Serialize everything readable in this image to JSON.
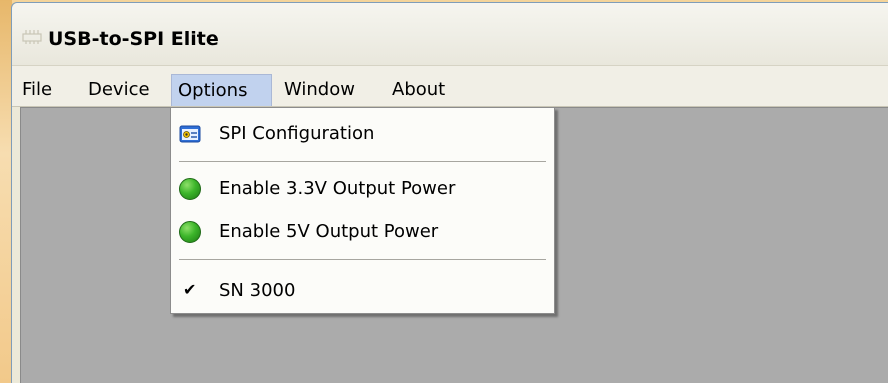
{
  "window": {
    "title": "USB-to-SPI Elite"
  },
  "menubar": {
    "items": [
      {
        "label": "File"
      },
      {
        "label": "Device"
      },
      {
        "label": "Options",
        "open": true
      },
      {
        "label": "Window"
      },
      {
        "label": "About"
      }
    ]
  },
  "options_menu": {
    "items": [
      {
        "label": "SPI Configuration",
        "icon": "config-window-icon"
      },
      {
        "label": "Enable 3.3V Output Power",
        "icon": "green-led-icon"
      },
      {
        "label": "Enable 5V Output Power",
        "icon": "green-led-icon"
      },
      {
        "label": "SN 3000",
        "icon": "checkmark-icon",
        "checked": true
      }
    ]
  },
  "colors": {
    "desktop": "#f4d49a",
    "menu_highlight": "#c1d2ee",
    "client_area": "#ababab",
    "led_green": "#3cb52a"
  }
}
